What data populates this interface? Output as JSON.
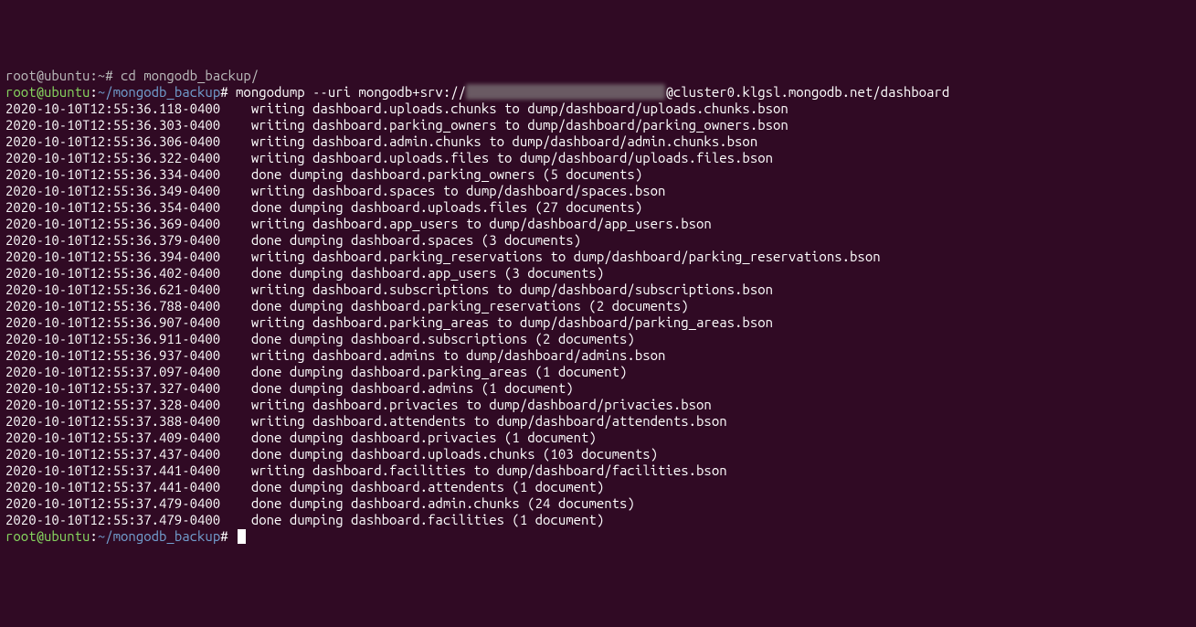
{
  "prompt": {
    "user_host": "root@ubuntu",
    "colon": ":",
    "path_prev": "~",
    "path": "~/mongodb_backup",
    "hash": "#"
  },
  "previous_cmd_fragment": "root@ubuntu:~# cd mongodb_backup/",
  "command": {
    "bin": "mongodump",
    "flag": "--uri",
    "uri_prefix": "mongodb+srv://",
    "uri_creds_masked": "xxxxxxx:xxxxxxxxxxxxxxxxxx",
    "uri_suffix": "@cluster0.klgsl.mongodb.net/dashboard"
  },
  "log_lines": [
    {
      "ts": "2020-10-10T12:55:36.118-0400",
      "msg": "writing dashboard.uploads.chunks to dump/dashboard/uploads.chunks.bson"
    },
    {
      "ts": "2020-10-10T12:55:36.303-0400",
      "msg": "writing dashboard.parking_owners to dump/dashboard/parking_owners.bson"
    },
    {
      "ts": "2020-10-10T12:55:36.306-0400",
      "msg": "writing dashboard.admin.chunks to dump/dashboard/admin.chunks.bson"
    },
    {
      "ts": "2020-10-10T12:55:36.322-0400",
      "msg": "writing dashboard.uploads.files to dump/dashboard/uploads.files.bson"
    },
    {
      "ts": "2020-10-10T12:55:36.334-0400",
      "msg": "done dumping dashboard.parking_owners (5 documents)"
    },
    {
      "ts": "2020-10-10T12:55:36.349-0400",
      "msg": "writing dashboard.spaces to dump/dashboard/spaces.bson"
    },
    {
      "ts": "2020-10-10T12:55:36.354-0400",
      "msg": "done dumping dashboard.uploads.files (27 documents)"
    },
    {
      "ts": "2020-10-10T12:55:36.369-0400",
      "msg": "writing dashboard.app_users to dump/dashboard/app_users.bson"
    },
    {
      "ts": "2020-10-10T12:55:36.379-0400",
      "msg": "done dumping dashboard.spaces (3 documents)"
    },
    {
      "ts": "2020-10-10T12:55:36.394-0400",
      "msg": "writing dashboard.parking_reservations to dump/dashboard/parking_reservations.bson"
    },
    {
      "ts": "2020-10-10T12:55:36.402-0400",
      "msg": "done dumping dashboard.app_users (3 documents)"
    },
    {
      "ts": "2020-10-10T12:55:36.621-0400",
      "msg": "writing dashboard.subscriptions to dump/dashboard/subscriptions.bson"
    },
    {
      "ts": "2020-10-10T12:55:36.788-0400",
      "msg": "done dumping dashboard.parking_reservations (2 documents)"
    },
    {
      "ts": "2020-10-10T12:55:36.907-0400",
      "msg": "writing dashboard.parking_areas to dump/dashboard/parking_areas.bson"
    },
    {
      "ts": "2020-10-10T12:55:36.911-0400",
      "msg": "done dumping dashboard.subscriptions (2 documents)"
    },
    {
      "ts": "2020-10-10T12:55:36.937-0400",
      "msg": "writing dashboard.admins to dump/dashboard/admins.bson"
    },
    {
      "ts": "2020-10-10T12:55:37.097-0400",
      "msg": "done dumping dashboard.parking_areas (1 document)"
    },
    {
      "ts": "2020-10-10T12:55:37.327-0400",
      "msg": "done dumping dashboard.admins (1 document)"
    },
    {
      "ts": "2020-10-10T12:55:37.328-0400",
      "msg": "writing dashboard.privacies to dump/dashboard/privacies.bson"
    },
    {
      "ts": "2020-10-10T12:55:37.388-0400",
      "msg": "writing dashboard.attendents to dump/dashboard/attendents.bson"
    },
    {
      "ts": "2020-10-10T12:55:37.409-0400",
      "msg": "done dumping dashboard.privacies (1 document)"
    },
    {
      "ts": "2020-10-10T12:55:37.437-0400",
      "msg": "done dumping dashboard.uploads.chunks (103 documents)"
    },
    {
      "ts": "2020-10-10T12:55:37.441-0400",
      "msg": "writing dashboard.facilities to dump/dashboard/facilities.bson"
    },
    {
      "ts": "2020-10-10T12:55:37.441-0400",
      "msg": "done dumping dashboard.attendents (1 document)"
    },
    {
      "ts": "2020-10-10T12:55:37.479-0400",
      "msg": "done dumping dashboard.admin.chunks (24 documents)"
    },
    {
      "ts": "2020-10-10T12:55:37.479-0400",
      "msg": "done dumping dashboard.facilities (1 document)"
    }
  ]
}
